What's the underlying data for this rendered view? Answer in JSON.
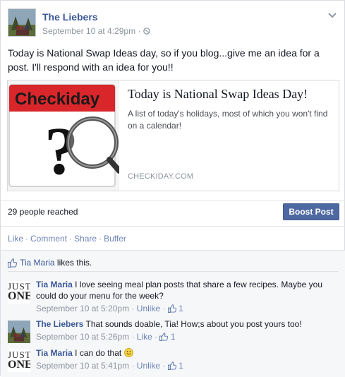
{
  "post": {
    "page_name": "The Liebers",
    "date": "September 10 at 4:29pm",
    "meta_sep": "·",
    "text": "Today is National Swap Ideas day, so if you blog...give me an idea for a post. I'll respond with an idea for you!!"
  },
  "link": {
    "image_label": "Checkiday",
    "image_symbol": "?",
    "title": "Today is National Swap Ideas Day!",
    "description": "A list of today's holidays, most of which you won't find on a calendar!",
    "domain": "CHECKIDAY.COM"
  },
  "stats": {
    "reach": "29 people reached",
    "boost_label": "Boost Post"
  },
  "actions": [
    "Like",
    "Comment",
    "Share",
    "Buffer"
  ],
  "likes": {
    "name": "Tia Maria",
    "suffix": " likes this."
  },
  "comments": [
    {
      "author": "Tia Maria",
      "avatar_line1": "JUST",
      "avatar_line2": "ONE",
      "text": "I love seeing meal plan posts that share a few recipes. Maybe you could do your menu for the week?",
      "time": "September 10 at 5:20pm",
      "action": "Unlike",
      "likes": "1"
    },
    {
      "author": "The Liebers",
      "text": "That sounds doable, Tia! How;s about you post yours too!",
      "time": "September 10 at 5:26pm",
      "action": "Like",
      "likes": "1"
    },
    {
      "author": "Tia Maria",
      "avatar_line1": "JUST",
      "avatar_line2": "ONE",
      "text": "I can do that",
      "time": "September 10 at 5:41pm",
      "action": "Unlike",
      "likes": "1"
    }
  ],
  "colors": {
    "link_blue": "#3b5998",
    "boost_blue": "#4e69a2",
    "checkiday_red": "#d8262a"
  }
}
